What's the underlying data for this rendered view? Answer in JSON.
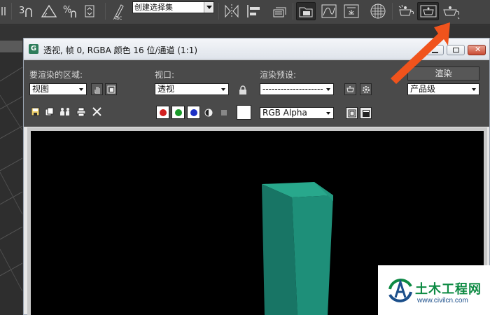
{
  "toolbar": {
    "selection_set": "创建选择集",
    "buttons": [
      "unlink-icon",
      "snap-3d-icon",
      "angle-snap-icon",
      "percent-snap-icon",
      "spinner-snap-icon",
      "edit-named-selection-icon",
      "mirror-icon",
      "align-icon",
      "layer-manager-icon",
      "graphite-modeling-icon",
      "curve-editor-icon",
      "schematic-view-icon",
      "material-editor-icon",
      "render-setup-icon",
      "rendered-frame-window-icon",
      "render-production-icon"
    ]
  },
  "render_window": {
    "title": "透视, 帧 0, RGBA 颜色 16 位/通道 (1:1)",
    "area_label": "要渲染的区域:",
    "area_value": "视图",
    "viewport_label": "视口:",
    "viewport_value": "透视",
    "preset_label": "渲染预设:",
    "preset_value": "--------------------",
    "render_button": "渲染",
    "quality_value": "产品级",
    "channel_value": "RGB Alpha"
  },
  "colors": {
    "accent_arrow": "#f0531c",
    "object": "#1f9f86",
    "watermark_green": "#0d8a43"
  },
  "watermark": {
    "name": "土木工程网",
    "url": "www.civilcn.com"
  }
}
